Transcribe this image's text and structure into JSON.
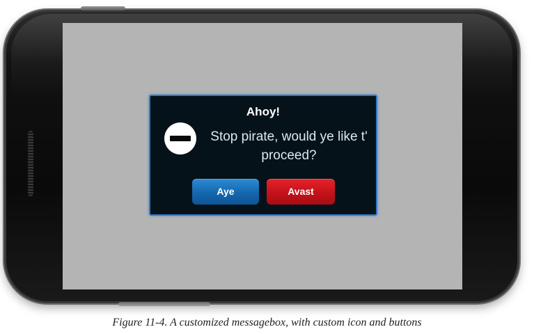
{
  "dialog": {
    "title": "Ahoy!",
    "icon": "minus-circle-icon",
    "message": "Stop pirate, would ye like t' proceed?",
    "buttons": {
      "confirm_label": "Aye",
      "cancel_label": "Avast"
    },
    "colors": {
      "background": "#06121a",
      "border": "#2f78c7",
      "confirm_button": "#1467ad",
      "cancel_button": "#c3121a"
    }
  },
  "screen": {
    "background": "#b4b4b4"
  },
  "caption": "Figure 11-4. A customized messagebox, with custom icon and buttons"
}
